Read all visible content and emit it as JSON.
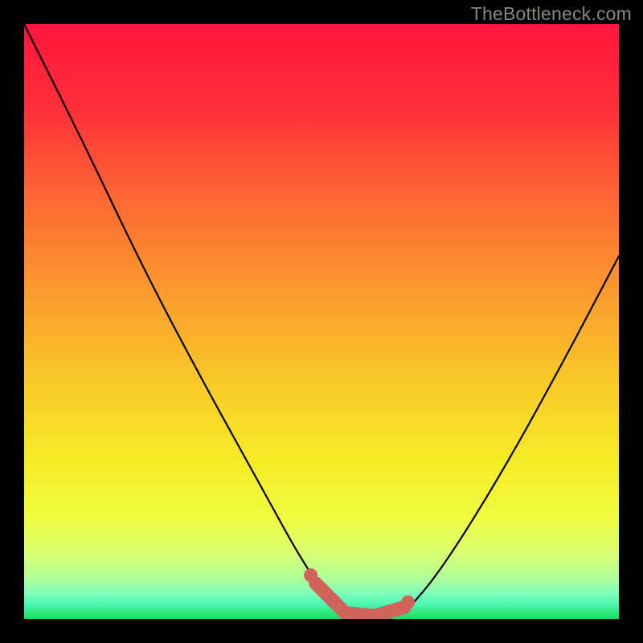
{
  "watermark": {
    "text": "TheBottleneck.com"
  },
  "colors": {
    "frame": "#000000",
    "curve": "#000000",
    "marker": "#d1625c",
    "gradient_stops": [
      {
        "offset": 0.0,
        "color": "#ff153d"
      },
      {
        "offset": 0.14,
        "color": "#ff2f3a"
      },
      {
        "offset": 0.3,
        "color": "#fd6a33"
      },
      {
        "offset": 0.45,
        "color": "#fb9a2e"
      },
      {
        "offset": 0.6,
        "color": "#f9c928"
      },
      {
        "offset": 0.74,
        "color": "#f6ed27"
      },
      {
        "offset": 0.83,
        "color": "#effc40"
      },
      {
        "offset": 0.89,
        "color": "#d9ff73"
      },
      {
        "offset": 0.932,
        "color": "#b0ff99"
      },
      {
        "offset": 0.955,
        "color": "#84febd"
      },
      {
        "offset": 0.975,
        "color": "#4ff8b2"
      },
      {
        "offset": 0.99,
        "color": "#2ae87a"
      },
      {
        "offset": 1.0,
        "color": "#1fde63"
      }
    ]
  },
  "chart_data": {
    "type": "line",
    "title": "",
    "xlabel": "",
    "ylabel": "",
    "xlim": [
      0,
      100
    ],
    "ylim": [
      0,
      100
    ],
    "series": [
      {
        "name": "left_arm",
        "x": [
          0,
          10,
          20,
          30,
          40,
          46,
          50,
          54
        ],
        "y": [
          100,
          80,
          59,
          40,
          22,
          11,
          5,
          1
        ]
      },
      {
        "name": "flat_bottom",
        "x": [
          54,
          58,
          62,
          64
        ],
        "y": [
          1,
          0.5,
          0.5,
          1
        ]
      },
      {
        "name": "right_arm",
        "x": [
          64,
          70,
          80,
          90,
          100
        ],
        "y": [
          1,
          8,
          24,
          42,
          61
        ]
      }
    ],
    "markers": {
      "name": "optimal_range",
      "points": [
        {
          "x": 49,
          "y": 6
        },
        {
          "x": 54,
          "y": 1
        },
        {
          "x": 59,
          "y": 0.5
        },
        {
          "x": 64,
          "y": 2
        }
      ]
    }
  }
}
